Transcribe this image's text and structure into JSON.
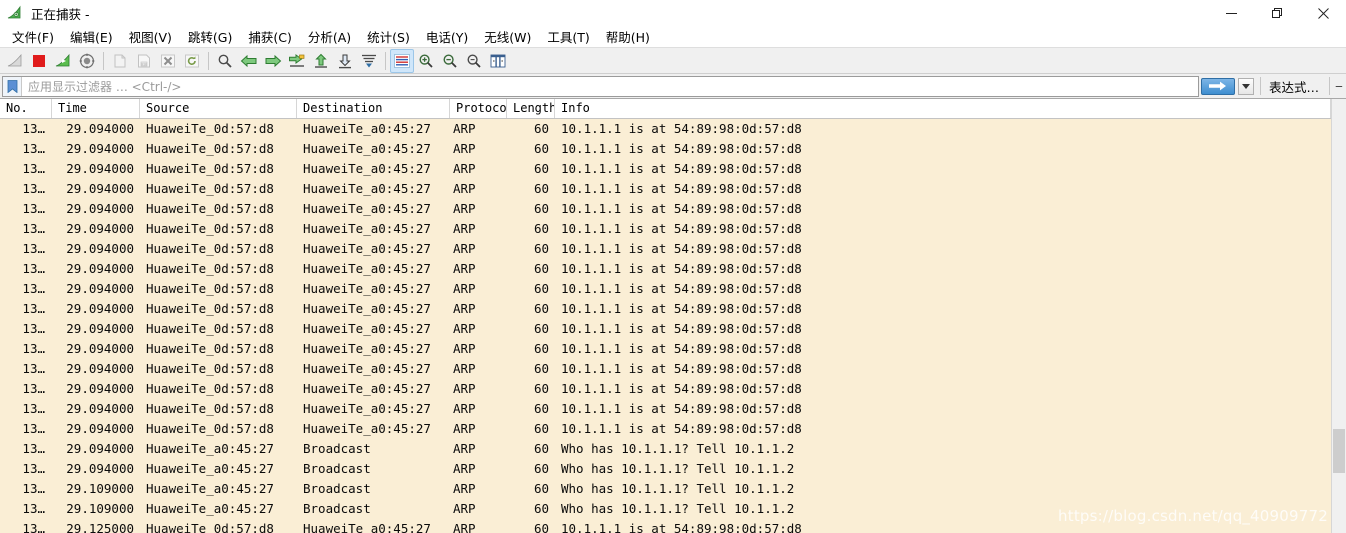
{
  "window": {
    "title": "正在捕获 -",
    "icon": "wireshark-shark-fin-icon",
    "minimize_label": "—",
    "maximize_label": "❐",
    "close_label": "✕"
  },
  "menubar": {
    "items": [
      {
        "name": "file",
        "label": "文件(F)",
        "text": "文件",
        "accel": "F"
      },
      {
        "name": "edit",
        "label": "编辑(E)",
        "text": "编辑",
        "accel": "E"
      },
      {
        "name": "view",
        "label": "视图(V)",
        "text": "视图",
        "accel": "V"
      },
      {
        "name": "go",
        "label": "跳转(G)",
        "text": "跳转",
        "accel": "G"
      },
      {
        "name": "capture",
        "label": "捕获(C)",
        "text": "捕获",
        "accel": "C"
      },
      {
        "name": "analyze",
        "label": "分析(A)",
        "text": "分析",
        "accel": "A"
      },
      {
        "name": "statistics",
        "label": "统计(S)",
        "text": "统计",
        "accel": "S"
      },
      {
        "name": "telephony",
        "label": "电话(Y)",
        "text": "电话",
        "accel": "Y"
      },
      {
        "name": "wireless",
        "label": "无线(W)",
        "text": "无线",
        "accel": "W"
      },
      {
        "name": "tools",
        "label": "工具(T)",
        "text": "工具",
        "accel": "T"
      },
      {
        "name": "help",
        "label": "帮助(H)",
        "text": "帮助",
        "accel": "H"
      }
    ]
  },
  "toolbar": {
    "buttons": [
      {
        "name": "start-capture-icon",
        "glyph": "shark-fin",
        "enabled": true
      },
      {
        "name": "stop-capture-icon",
        "glyph": "red-square",
        "enabled": true
      },
      {
        "name": "restart-capture-icon",
        "glyph": "shark-fin-green",
        "enabled": true
      },
      {
        "name": "capture-options-icon",
        "glyph": "gear",
        "enabled": true
      },
      {
        "name": "open-file-icon",
        "glyph": "folder",
        "enabled": false
      },
      {
        "name": "save-file-icon",
        "glyph": "save-disk",
        "enabled": false
      },
      {
        "name": "close-file-icon",
        "glyph": "close-x",
        "enabled": false
      },
      {
        "name": "reload-file-icon",
        "glyph": "reload",
        "enabled": false
      },
      {
        "name": "find-packet-icon",
        "glyph": "magnifier",
        "enabled": true
      },
      {
        "name": "go-back-icon",
        "glyph": "arrow-left",
        "enabled": true
      },
      {
        "name": "go-forward-icon",
        "glyph": "arrow-right",
        "enabled": true
      },
      {
        "name": "go-to-packet-icon",
        "glyph": "goto-packet",
        "enabled": true
      },
      {
        "name": "go-first-packet-icon",
        "glyph": "arrow-up",
        "enabled": true
      },
      {
        "name": "go-last-packet-icon",
        "glyph": "arrow-down",
        "enabled": true
      },
      {
        "name": "auto-scroll-icon",
        "glyph": "autoscroll",
        "enabled": true
      },
      {
        "name": "colorize-packets-icon",
        "glyph": "colorize",
        "enabled": true,
        "active": true
      },
      {
        "name": "zoom-in-icon",
        "glyph": "zoom-in",
        "enabled": true
      },
      {
        "name": "zoom-out-icon",
        "glyph": "zoom-out",
        "enabled": true
      },
      {
        "name": "zoom-reset-icon",
        "glyph": "zoom-reset",
        "enabled": true
      },
      {
        "name": "resize-columns-icon",
        "glyph": "resize-columns",
        "enabled": true
      }
    ]
  },
  "filterbar": {
    "bookmark_icon": "filter-bookmark-icon",
    "placeholder": "应用显示过滤器 … <Ctrl-/>",
    "value": "",
    "apply_icon": "arrow-right-apply-icon",
    "dropdown_icon": "chevron-down-icon",
    "expression_label": "表达式…",
    "collapse_label": "‒"
  },
  "packet_list": {
    "columns": [
      {
        "key": "no",
        "label": "No."
      },
      {
        "key": "time",
        "label": "Time"
      },
      {
        "key": "src",
        "label": "Source"
      },
      {
        "key": "dst",
        "label": "Destination"
      },
      {
        "key": "proto",
        "label": "Protocol"
      },
      {
        "key": "len",
        "label": "Length"
      },
      {
        "key": "info",
        "label": "Info"
      }
    ],
    "rows": [
      {
        "no": "13…",
        "time": "29.094000",
        "src": "HuaweiTe_0d:57:d8",
        "dst": "HuaweiTe_a0:45:27",
        "proto": "ARP",
        "len": "60",
        "info": "10.1.1.1 is at 54:89:98:0d:57:d8"
      },
      {
        "no": "13…",
        "time": "29.094000",
        "src": "HuaweiTe_0d:57:d8",
        "dst": "HuaweiTe_a0:45:27",
        "proto": "ARP",
        "len": "60",
        "info": "10.1.1.1 is at 54:89:98:0d:57:d8"
      },
      {
        "no": "13…",
        "time": "29.094000",
        "src": "HuaweiTe_0d:57:d8",
        "dst": "HuaweiTe_a0:45:27",
        "proto": "ARP",
        "len": "60",
        "info": "10.1.1.1 is at 54:89:98:0d:57:d8"
      },
      {
        "no": "13…",
        "time": "29.094000",
        "src": "HuaweiTe_0d:57:d8",
        "dst": "HuaweiTe_a0:45:27",
        "proto": "ARP",
        "len": "60",
        "info": "10.1.1.1 is at 54:89:98:0d:57:d8"
      },
      {
        "no": "13…",
        "time": "29.094000",
        "src": "HuaweiTe_0d:57:d8",
        "dst": "HuaweiTe_a0:45:27",
        "proto": "ARP",
        "len": "60",
        "info": "10.1.1.1 is at 54:89:98:0d:57:d8"
      },
      {
        "no": "13…",
        "time": "29.094000",
        "src": "HuaweiTe_0d:57:d8",
        "dst": "HuaweiTe_a0:45:27",
        "proto": "ARP",
        "len": "60",
        "info": "10.1.1.1 is at 54:89:98:0d:57:d8"
      },
      {
        "no": "13…",
        "time": "29.094000",
        "src": "HuaweiTe_0d:57:d8",
        "dst": "HuaweiTe_a0:45:27",
        "proto": "ARP",
        "len": "60",
        "info": "10.1.1.1 is at 54:89:98:0d:57:d8"
      },
      {
        "no": "13…",
        "time": "29.094000",
        "src": "HuaweiTe_0d:57:d8",
        "dst": "HuaweiTe_a0:45:27",
        "proto": "ARP",
        "len": "60",
        "info": "10.1.1.1 is at 54:89:98:0d:57:d8"
      },
      {
        "no": "13…",
        "time": "29.094000",
        "src": "HuaweiTe_0d:57:d8",
        "dst": "HuaweiTe_a0:45:27",
        "proto": "ARP",
        "len": "60",
        "info": "10.1.1.1 is at 54:89:98:0d:57:d8"
      },
      {
        "no": "13…",
        "time": "29.094000",
        "src": "HuaweiTe_0d:57:d8",
        "dst": "HuaweiTe_a0:45:27",
        "proto": "ARP",
        "len": "60",
        "info": "10.1.1.1 is at 54:89:98:0d:57:d8"
      },
      {
        "no": "13…",
        "time": "29.094000",
        "src": "HuaweiTe_0d:57:d8",
        "dst": "HuaweiTe_a0:45:27",
        "proto": "ARP",
        "len": "60",
        "info": "10.1.1.1 is at 54:89:98:0d:57:d8"
      },
      {
        "no": "13…",
        "time": "29.094000",
        "src": "HuaweiTe_0d:57:d8",
        "dst": "HuaweiTe_a0:45:27",
        "proto": "ARP",
        "len": "60",
        "info": "10.1.1.1 is at 54:89:98:0d:57:d8"
      },
      {
        "no": "13…",
        "time": "29.094000",
        "src": "HuaweiTe_0d:57:d8",
        "dst": "HuaweiTe_a0:45:27",
        "proto": "ARP",
        "len": "60",
        "info": "10.1.1.1 is at 54:89:98:0d:57:d8"
      },
      {
        "no": "13…",
        "time": "29.094000",
        "src": "HuaweiTe_0d:57:d8",
        "dst": "HuaweiTe_a0:45:27",
        "proto": "ARP",
        "len": "60",
        "info": "10.1.1.1 is at 54:89:98:0d:57:d8"
      },
      {
        "no": "13…",
        "time": "29.094000",
        "src": "HuaweiTe_0d:57:d8",
        "dst": "HuaweiTe_a0:45:27",
        "proto": "ARP",
        "len": "60",
        "info": "10.1.1.1 is at 54:89:98:0d:57:d8"
      },
      {
        "no": "13…",
        "time": "29.094000",
        "src": "HuaweiTe_0d:57:d8",
        "dst": "HuaweiTe_a0:45:27",
        "proto": "ARP",
        "len": "60",
        "info": "10.1.1.1 is at 54:89:98:0d:57:d8"
      },
      {
        "no": "13…",
        "time": "29.094000",
        "src": "HuaweiTe_a0:45:27",
        "dst": "Broadcast",
        "proto": "ARP",
        "len": "60",
        "info": "Who has 10.1.1.1? Tell 10.1.1.2"
      },
      {
        "no": "13…",
        "time": "29.094000",
        "src": "HuaweiTe_a0:45:27",
        "dst": "Broadcast",
        "proto": "ARP",
        "len": "60",
        "info": "Who has 10.1.1.1? Tell 10.1.1.2"
      },
      {
        "no": "13…",
        "time": "29.109000",
        "src": "HuaweiTe_a0:45:27",
        "dst": "Broadcast",
        "proto": "ARP",
        "len": "60",
        "info": "Who has 10.1.1.1? Tell 10.1.1.2"
      },
      {
        "no": "13…",
        "time": "29.109000",
        "src": "HuaweiTe_a0:45:27",
        "dst": "Broadcast",
        "proto": "ARP",
        "len": "60",
        "info": "Who has 10.1.1.1? Tell 10.1.1.2"
      },
      {
        "no": "13…",
        "time": "29.125000",
        "src": "HuaweiTe_0d:57:d8",
        "dst": "HuaweiTe_a0:45:27",
        "proto": "ARP",
        "len": "60",
        "info": "10.1.1.1 is at 54:89:98:0d:57:d8"
      }
    ]
  },
  "watermark": {
    "text": "https://blog.csdn.net/qq_40909772"
  },
  "colors": {
    "row_background": "#faeed5",
    "row_text": "#0b0b0b",
    "chrome": "#f0f0f0",
    "accent_blue": "#3f8ed0",
    "stop_red": "#e01b1b",
    "shark_green": "#3aa83a"
  }
}
